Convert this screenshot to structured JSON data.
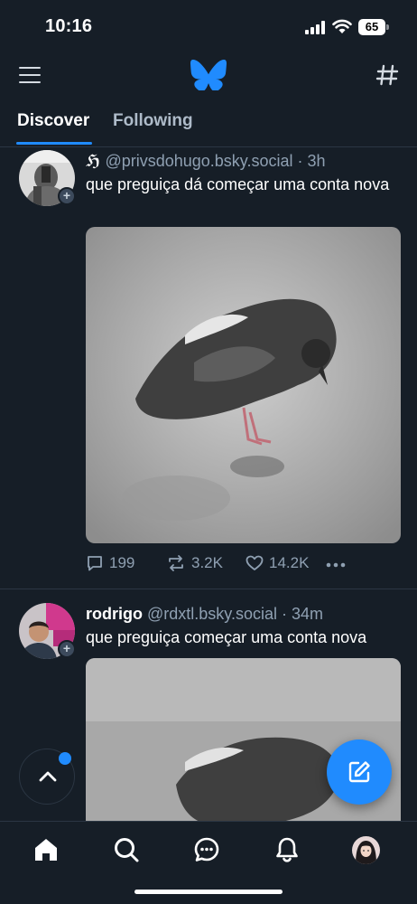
{
  "status_bar": {
    "time": "10:16",
    "battery": "65"
  },
  "header": {
    "logo_icon": "butterfly-icon",
    "menu_icon": "hamburger-icon",
    "feeds_icon": "hashtag-icon",
    "accent": "#208bfe"
  },
  "tabs": [
    {
      "label": "Discover",
      "active": true
    },
    {
      "label": "Following",
      "active": false
    }
  ],
  "posts": [
    {
      "author_symbol": "ℌ",
      "handle": "@privsdohugo.bsky.social",
      "separator": "·",
      "time": "3h",
      "text": "que preguiça dá começar uma conta nova",
      "replies": "199",
      "reposts": "3.2K",
      "likes": "14.2K"
    },
    {
      "display_name": "rodrigo",
      "handle": "@rdxtl.bsky.social",
      "separator": "·",
      "time": "34m",
      "text": "que preguiça começar uma conta nova"
    }
  ],
  "nav": {
    "items": [
      "home-icon",
      "search-icon",
      "chat-icon",
      "bell-icon",
      "profile-avatar"
    ]
  }
}
